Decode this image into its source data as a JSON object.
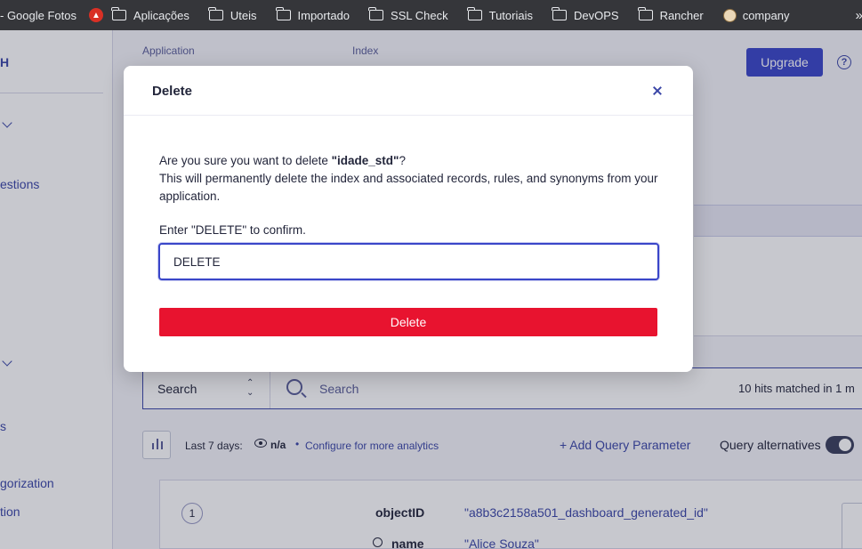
{
  "bookmarks": {
    "items": [
      {
        "label": "- Google Fotos",
        "icon": "none"
      },
      {
        "label": "Aplicações",
        "icon": "folder-icon"
      },
      {
        "label": "Uteis",
        "icon": "folder-icon"
      },
      {
        "label": "Importado",
        "icon": "folder-icon"
      },
      {
        "label": "SSL Check",
        "icon": "folder-icon"
      },
      {
        "label": "Tutoriais",
        "icon": "folder-icon"
      },
      {
        "label": "DevOPS",
        "icon": "folder-icon"
      },
      {
        "label": "Rancher",
        "icon": "folder-icon"
      },
      {
        "label": "company",
        "icon": "avatar-icon"
      }
    ],
    "more": "»"
  },
  "sidebar": {
    "logo_fragment": "H",
    "items": [
      "estions",
      "s",
      "gorization",
      "tion"
    ]
  },
  "topbar": {
    "application_label": "Application",
    "index_label": "Index",
    "upgrade_label": "Upgrade",
    "help_symbol": "?"
  },
  "search": {
    "select_label": "Search",
    "placeholder": "Search",
    "hits_text": "10 hits matched in 1 m"
  },
  "analytics": {
    "period_label": "Last 7 days:",
    "value": "n/a",
    "separator": "•",
    "configure_link": "Configure for more analytics",
    "add_param_label": "+ Add Query Parameter",
    "alternatives_label": "Query alternatives"
  },
  "record": {
    "number": "1",
    "fields": [
      {
        "key": "objectID",
        "value": "\"a8b3c2158a501_dashboard_generated_id\""
      },
      {
        "key": "name",
        "value": "\"Alice Souza\""
      }
    ]
  },
  "modal": {
    "title": "Delete",
    "question_prefix": "Are you sure you want to delete ",
    "index_name": "\"idade_std\"",
    "question_suffix": "?",
    "warning": "This will permanently delete the index and associated records, rules, and synonyms from your application.",
    "confirm_label": "Enter \"DELETE\" to confirm.",
    "input_value": "DELETE",
    "delete_button": "Delete"
  },
  "colors": {
    "accent": "#3a46c9",
    "danger": "#e8132f",
    "link": "#3a46a7"
  }
}
